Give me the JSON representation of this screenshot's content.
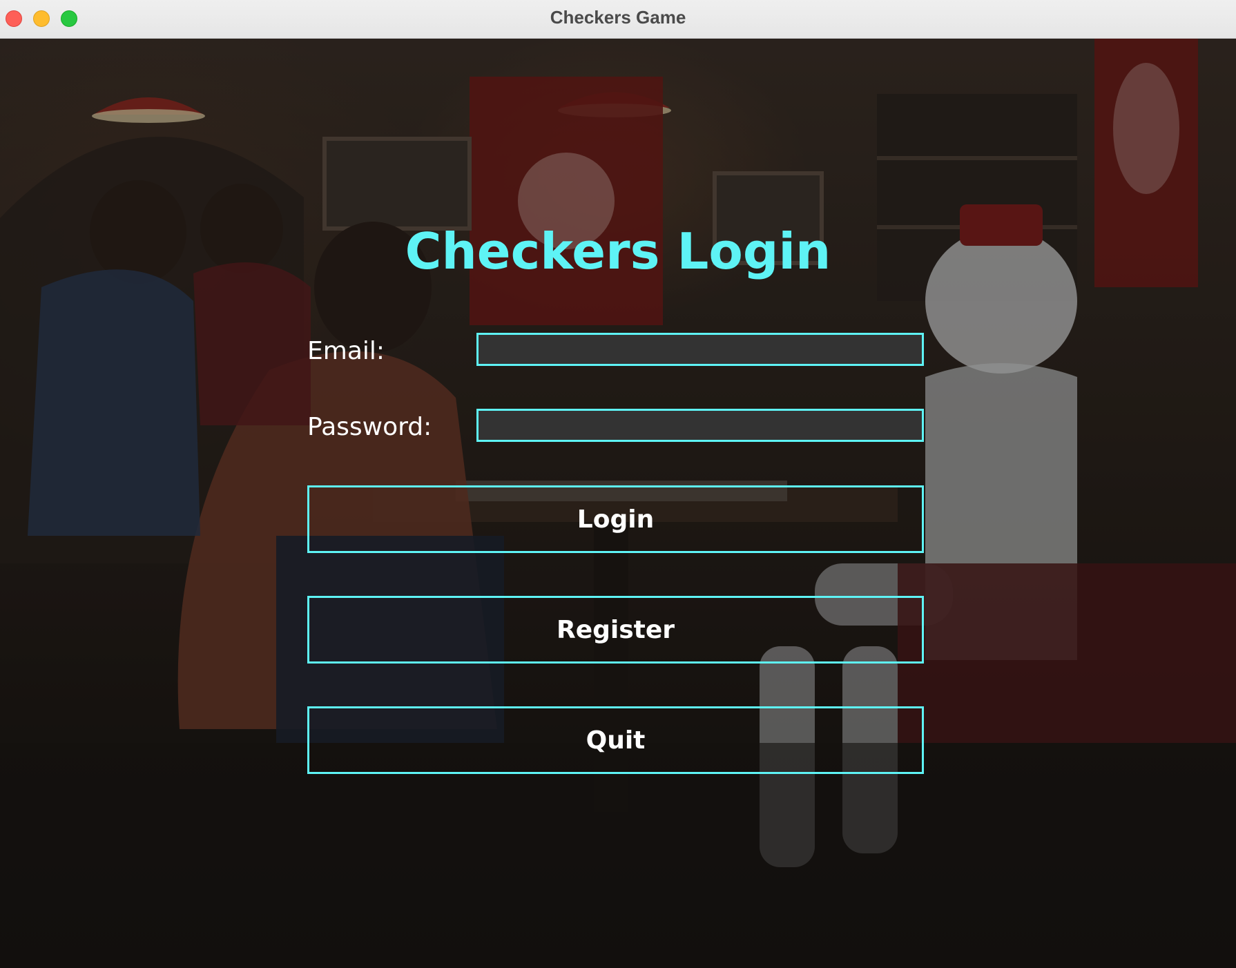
{
  "window": {
    "title": "Checkers Game",
    "controls": [
      "close",
      "minimize",
      "zoom"
    ]
  },
  "background": {
    "description_icon": "cafe-scene-background"
  },
  "login": {
    "title": "Checkers Login",
    "email_label": "Email:",
    "email_value": "",
    "password_label": "Password:",
    "password_value": "",
    "login_button": "Login",
    "register_button": "Register",
    "quit_button": "Quit"
  },
  "colors": {
    "accent": "#5ef3f5",
    "field_background": "#333333",
    "button_text": "#ffffff"
  }
}
